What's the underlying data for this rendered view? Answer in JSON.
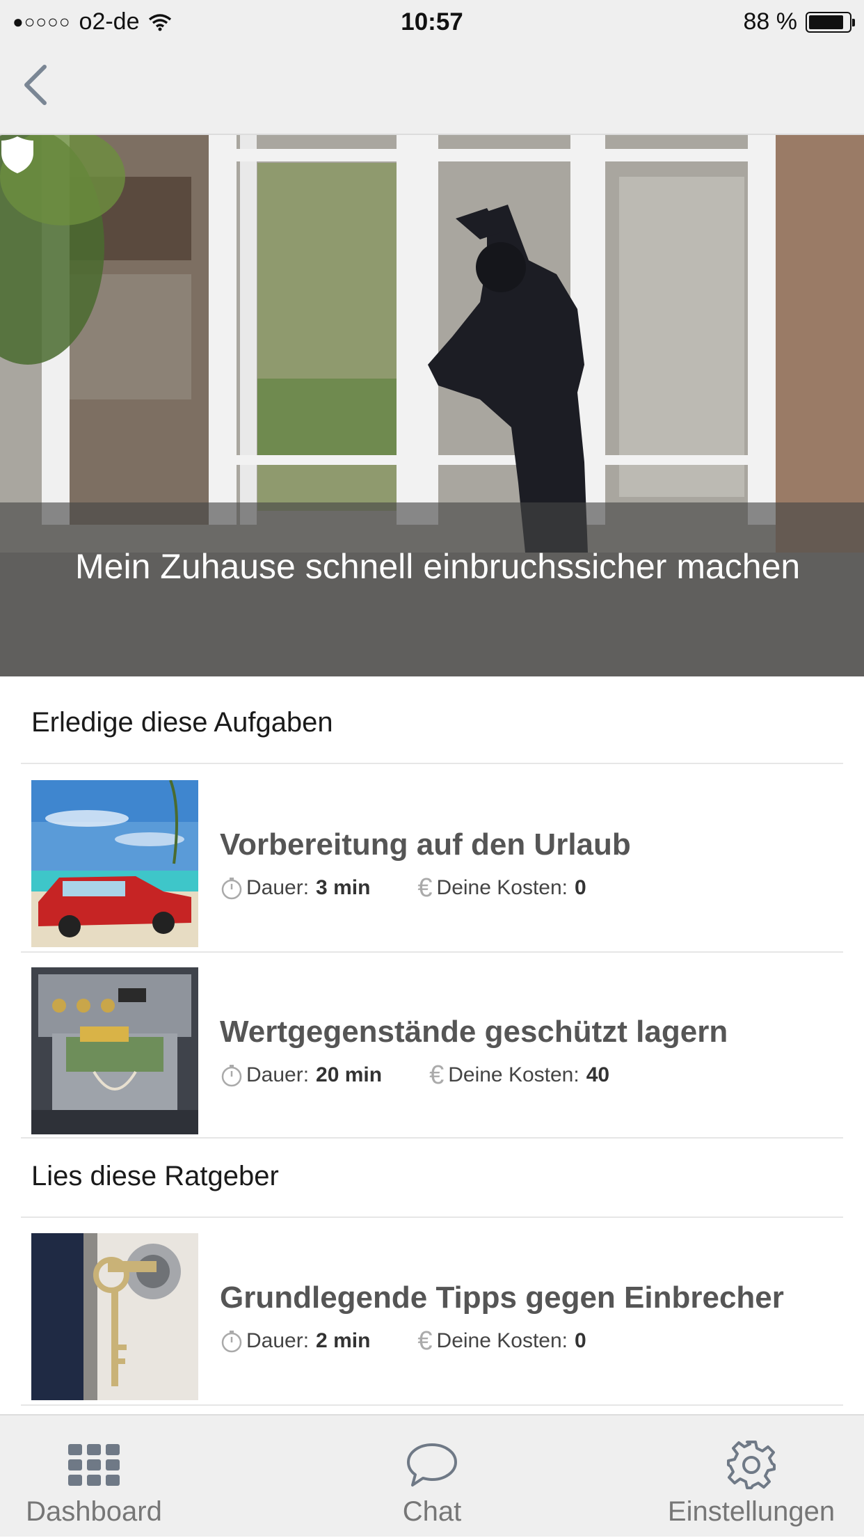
{
  "status_bar": {
    "signal": "●○○○○",
    "carrier": "o2-de",
    "time": "10:57",
    "battery": "88 %"
  },
  "hero": {
    "title": "Mein Zuhause schnell einbruchssicher machen"
  },
  "sections": {
    "tasks_heading": "Erledige diese Aufgaben",
    "guides_heading": "Lies diese Ratgeber"
  },
  "tasks": [
    {
      "title": "Vorbereitung auf den Urlaub",
      "duration_label": "Dauer:",
      "duration": "3 min",
      "cost_label": "Deine Kosten:",
      "cost": "0"
    },
    {
      "title": "Wertgegenstände geschützt lagern",
      "duration_label": "Dauer:",
      "duration": "20 min",
      "cost_label": "Deine Kosten:",
      "cost": "40"
    }
  ],
  "guides": [
    {
      "title": "Grundlegende Tipps gegen Einbrecher",
      "duration_label": "Dauer:",
      "duration": "2 min",
      "cost_label": "Deine Kosten:",
      "cost": "0"
    }
  ],
  "tabbar": {
    "dashboard": "Dashboard",
    "chat": "Chat",
    "settings": "Einstellungen"
  },
  "icons": {
    "currency": "€"
  },
  "colors": {
    "bar_bg": "#efefef",
    "tab_icon": "#6f7986",
    "title_text": "#555555"
  }
}
